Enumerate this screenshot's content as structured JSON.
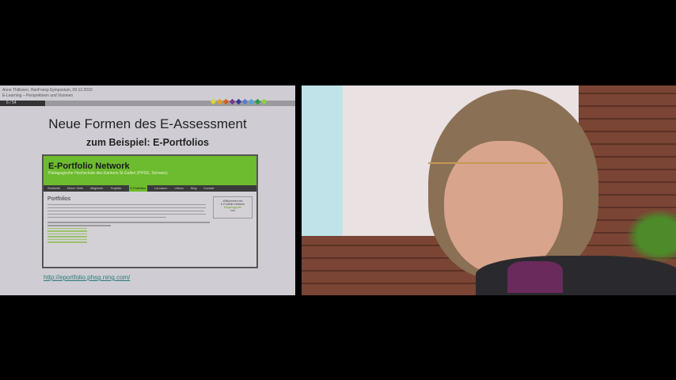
{
  "slide": {
    "header_line1": "Anne Thillosen, HanFoerg-Symposium, 09.12.2010",
    "header_line2": "E-Learning – Perspektiven und Visionen",
    "page": "6 / 54",
    "dot_colors": [
      "#d8d830",
      "#e0a020",
      "#d06020",
      "#7a3a8a",
      "#3a3a9a",
      "#5a7ad0",
      "#50a8d0",
      "#2a9a4a",
      "#8ad040"
    ],
    "title": "Neue Formen des E-Assessment",
    "subtitle": "zum Beispiel: E-Portfolios",
    "screenshot": {
      "site_name": "E-Portfolio Network",
      "tagline": "Pädagogische Hochschule des Kantons St.Gallen (PHSG, Schweiz)",
      "nav": [
        "Startseite",
        "Meine Seite",
        "Mitglieder",
        "Projekte",
        "E-Portfolios",
        "Lernraum",
        "Videos",
        "Blog",
        "Kontakt"
      ],
      "active_nav": "E-Portfolios",
      "heading": "Portfolios",
      "sidebar_box": [
        "Willkommen bei",
        "E-Portfolio Network",
        "Eingeloggt als",
        "von"
      ]
    },
    "url": "http://eportfolio.phsg.ning.com/"
  },
  "video": {
    "description_colors": {
      "brick": "#7a4534",
      "screen": "#e9e1e2"
    }
  }
}
